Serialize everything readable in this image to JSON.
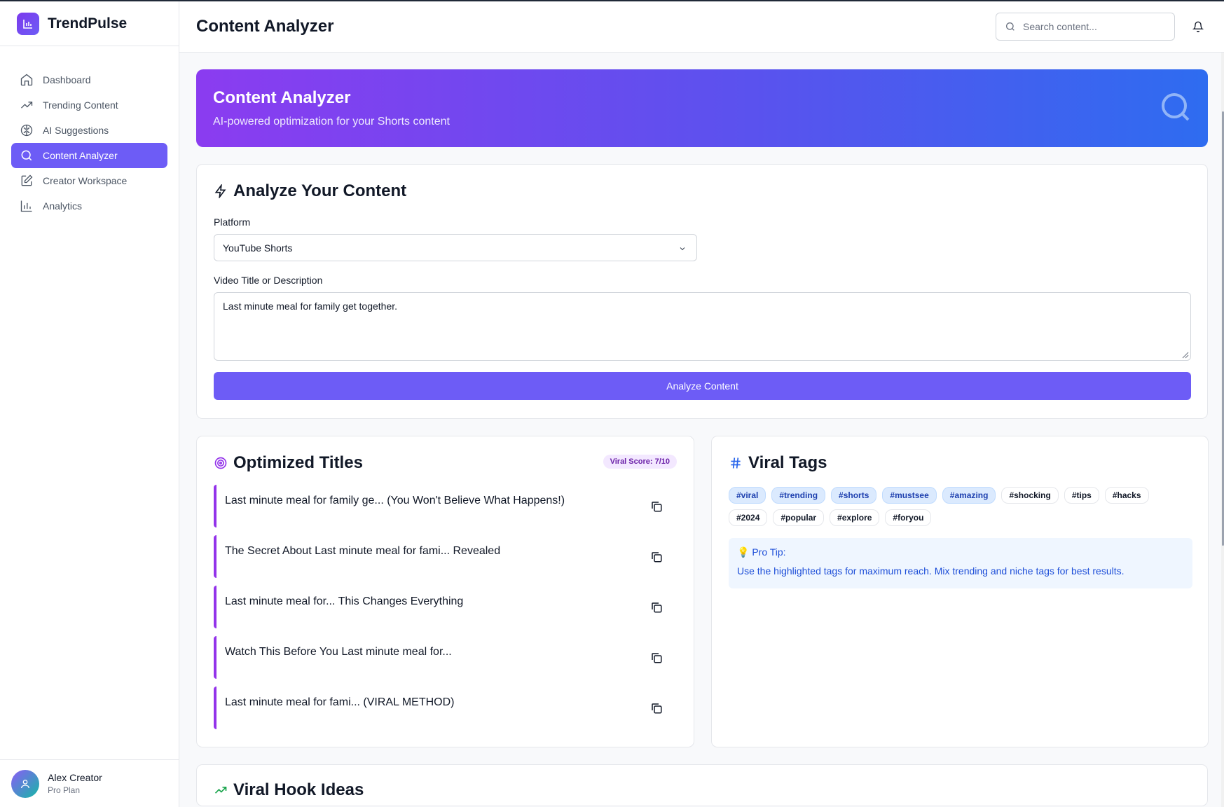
{
  "app": {
    "name": "TrendPulse"
  },
  "sidebar": {
    "items": [
      {
        "label": "Dashboard",
        "icon": "home-icon"
      },
      {
        "label": "Trending Content",
        "icon": "trending-up-icon"
      },
      {
        "label": "AI Suggestions",
        "icon": "brain-icon"
      },
      {
        "label": "Content Analyzer",
        "icon": "search-icon",
        "active": true
      },
      {
        "label": "Creator Workspace",
        "icon": "edit-icon"
      },
      {
        "label": "Analytics",
        "icon": "bar-chart-icon"
      }
    ],
    "user": {
      "name": "Alex Creator",
      "plan": "Pro Plan"
    }
  },
  "header": {
    "title": "Content Analyzer",
    "search_placeholder": "Search content..."
  },
  "hero": {
    "title": "Content Analyzer",
    "subtitle": "AI-powered optimization for your Shorts content"
  },
  "analyze": {
    "title": "Analyze Your Content",
    "platform_label": "Platform",
    "platform_value": "YouTube Shorts",
    "description_label": "Video Title or Description",
    "description_value": "Last minute meal for family get together.",
    "button_label": "Analyze Content"
  },
  "titles": {
    "heading": "Optimized Titles",
    "viral_score": "Viral Score: 7/10",
    "items": [
      "Last minute meal for family ge... (You Won't Believe What Happens!)",
      "The Secret About Last minute meal for fami... Revealed",
      "Last minute meal for... This Changes Everything",
      "Watch This Before You Last minute meal for...",
      "Last minute meal for fami... (VIRAL METHOD)"
    ]
  },
  "tags": {
    "heading": "Viral Tags",
    "items": [
      "#viral",
      "#trending",
      "#shorts",
      "#mustsee",
      "#amazing",
      "#shocking",
      "#tips",
      "#hacks",
      "#2024",
      "#popular",
      "#explore",
      "#foryou"
    ],
    "highlighted_count": 5,
    "tip_title": "Pro Tip:",
    "tip_text": "Use the highlighted tags for maximum reach. Mix trending and niche tags for best results."
  },
  "hooks": {
    "heading": "Viral Hook Ideas"
  },
  "colors": {
    "accent": "#6d5cf6",
    "title_border": "#9333ea",
    "tag_highlight": "#dbeafe"
  }
}
